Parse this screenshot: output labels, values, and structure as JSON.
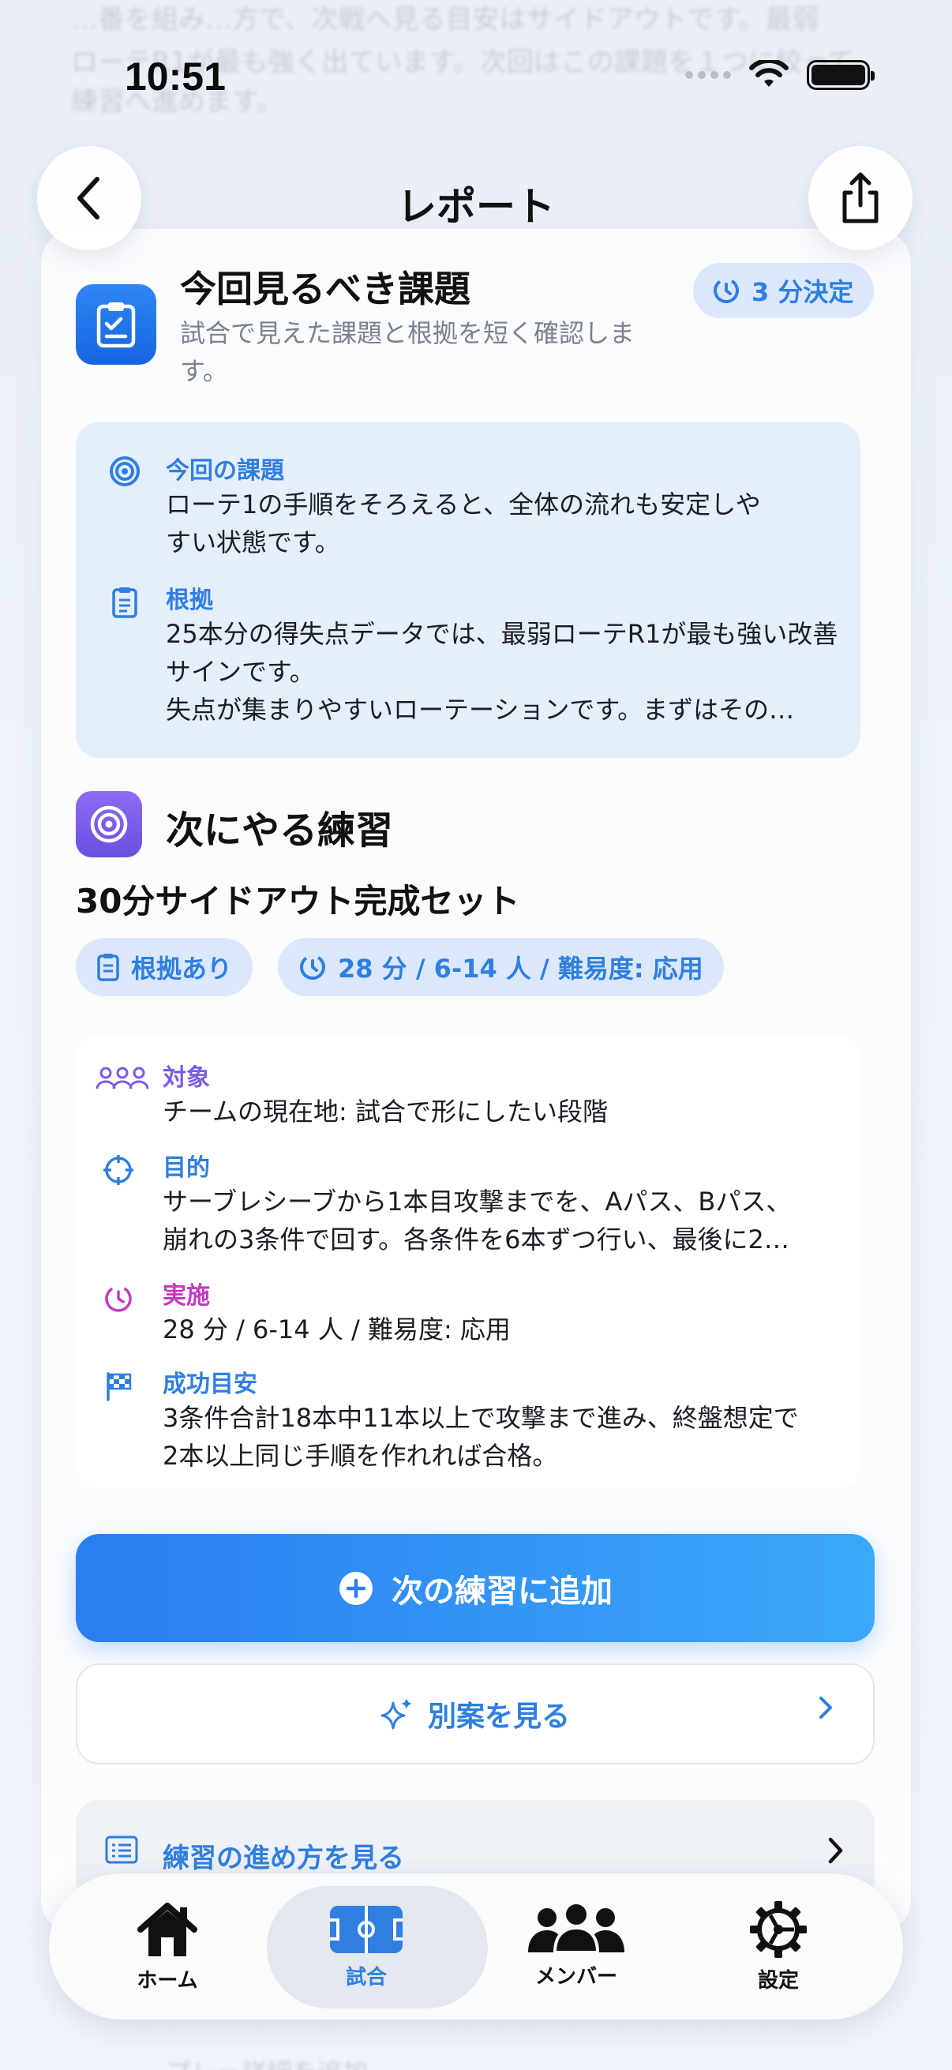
{
  "background": {
    "line1": "…番を組み…方で、次戦へ見る目安はサイドアウトです。最弱",
    "line2": "ローテR1が最も強く出ています。次回はこの課題を１つに絞って",
    "line3": "練習へ進めます。",
    "line4": "…",
    "bottom": "プレー詳細を追加"
  },
  "status_bar": {
    "time": "10:51"
  },
  "nav": {
    "title": "レポート"
  },
  "section_issue": {
    "title": "今回見るべき課題",
    "subtitle": "試合で見えた課題と根拠を短く確認します。",
    "badge": "3 分決定",
    "current_label": "今回の課題",
    "current_text": "ローテ1の手順をそろえると、全体の流れも安定しやすい状態です。",
    "basis_label": "根拠",
    "basis_text": "25本分の得失点データでは、最弱ローテR1が最も強い改善サインです。",
    "basis_text2": "失点が集まりやすいローテーションです。まずはその…"
  },
  "section_practice": {
    "title": "次にやる練習",
    "set_title": "30分サイドアウト完成セット",
    "chip_basis": "根拠あり",
    "chip_meta": "28 分 / 6-14 人 / 難易度: 応用",
    "target_label": "対象",
    "target_text": "チームの現在地: 試合で形にしたい段階",
    "purpose_label": "目的",
    "purpose_text1": "サーブレシーブから1本目攻撃までを、Aパス、Bパス、",
    "purpose_text2": "崩れの3条件で回す。各条件を6本ずつ行い、最後に2…",
    "execution_label": "実施",
    "execution_text": "28 分 / 6-14 人 / 難易度: 応用",
    "success_label": "成功目安",
    "success_text1": "3条件合計18本中11本以上で攻撃まで進み、終盤想定で",
    "success_text2": "2本以上同じ手順を作れれば合格。"
  },
  "buttons": {
    "add_next": "次の練習に追加",
    "alternatives": "別案を見る",
    "howto": "練習の進め方を見る"
  },
  "tabbar": {
    "home": "ホーム",
    "match": "試合",
    "members": "メンバー",
    "settings": "設定"
  },
  "colors": {
    "accent": "#2f7fe0",
    "primary_gradient_start": "#2a7ef0",
    "primary_gradient_end": "#3ba8f8",
    "practice_icon": "#7c5ce6",
    "execution_label": "#c33bc0"
  }
}
